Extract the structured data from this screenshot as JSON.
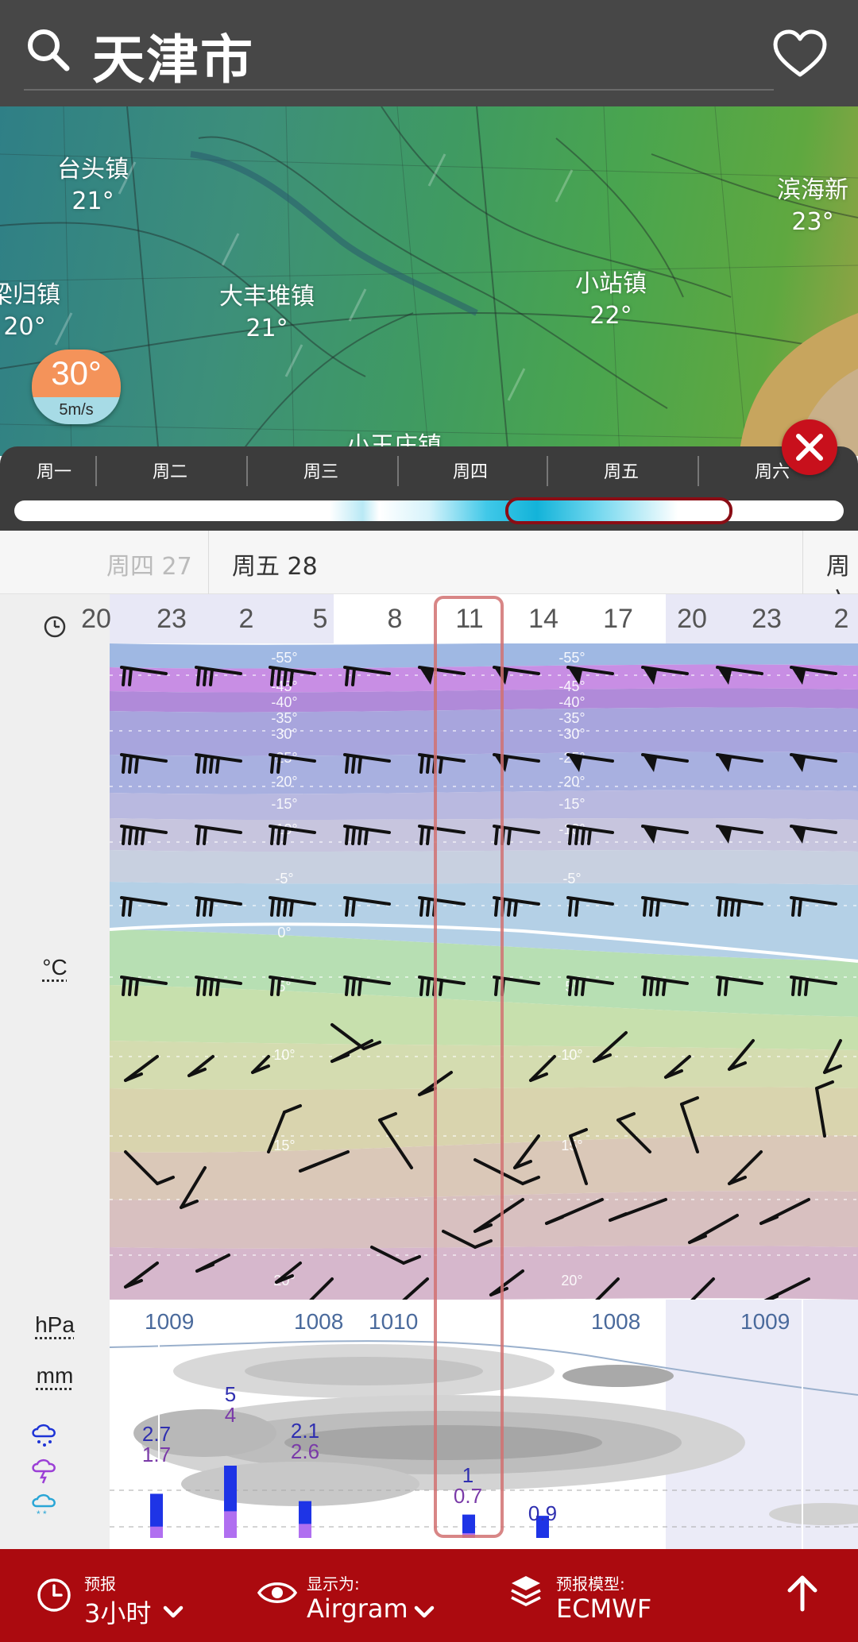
{
  "header": {
    "title": "天津市"
  },
  "map": {
    "towns": [
      {
        "name": "台头镇",
        "temp": "21°"
      },
      {
        "name": "滨海新",
        "temp": "23°"
      },
      {
        "name": "梁归镇",
        "temp": "20°"
      },
      {
        "name": "大丰堆镇",
        "temp": "21°"
      },
      {
        "name": "小站镇",
        "temp": "22°"
      },
      {
        "name": "小王庄镇",
        "temp": ""
      }
    ],
    "current": {
      "temp": "30°",
      "wind": "5m/s"
    }
  },
  "timeline": {
    "days": [
      "周一",
      "周二",
      "周三",
      "周四",
      "周五",
      "周六"
    ]
  },
  "dates": {
    "prev": "周四 27",
    "current": "周五 28",
    "next": "周六"
  },
  "hours": [
    "20",
    "23",
    "2",
    "5",
    "8",
    "11",
    "14",
    "17",
    "20",
    "23",
    "2"
  ],
  "isotherms": [
    "-55°",
    "-45°",
    "-40°",
    "-35°",
    "-30°",
    "-25°",
    "-20°",
    "-15°",
    "-10°",
    "-5°",
    "0°",
    "5°",
    "10°",
    "15°",
    "20°"
  ],
  "legend": {
    "temp_unit": "°C",
    "pressure_unit": "hPa",
    "precip_unit": "mm"
  },
  "pressure_values": [
    "1009",
    "1008",
    "1010",
    "1008",
    "1009"
  ],
  "precip": [
    {
      "top": "2.7",
      "bottom": "1.7"
    },
    {
      "top": "5",
      "bottom": "4"
    },
    {
      "top": "2.1",
      "bottom": "2.6"
    },
    {
      "top": "1",
      "bottom": "0.7"
    },
    {
      "top": "0.9",
      "bottom": ""
    }
  ],
  "bottom": {
    "forecast_caption": "预报",
    "forecast_value": "3小时",
    "display_caption": "显示为:",
    "display_value": "Airgram",
    "model_caption": "预报模型:",
    "model_value": "ECMWF"
  },
  "colors": {
    "accent": "#ab0a0f",
    "header": "#474747",
    "close": "#c8101c"
  }
}
